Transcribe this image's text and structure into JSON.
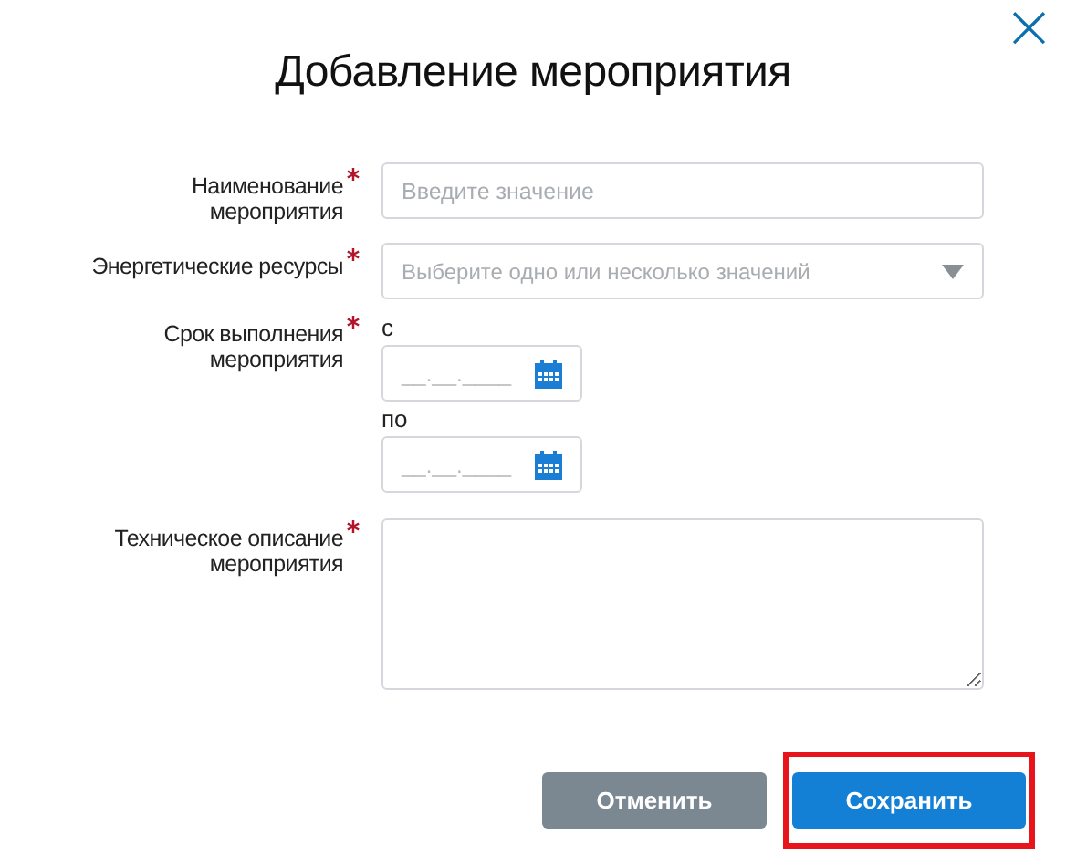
{
  "dialog": {
    "title": "Добавление мероприятия",
    "close": "×"
  },
  "fields": [
    {
      "kind": "text",
      "label": "Наименование мероприятия",
      "required": true,
      "placeholder": "Введите значение"
    },
    {
      "kind": "select",
      "label": "Энергетические ресурсы",
      "required": true,
      "placeholder": "Выберите одно или несколько значений"
    },
    {
      "kind": "daterange",
      "label": "Срок выполнения мероприятия",
      "required": true,
      "from_label": "с",
      "from_placeholder": "__.__.____",
      "to_label": "по",
      "to_placeholder": "__.__.____"
    },
    {
      "kind": "textarea",
      "label": "Техническое описание мероприятия",
      "required": true
    }
  ],
  "buttons": [
    {
      "kind": "secondary",
      "label": "Отменить",
      "highlighted": false
    },
    {
      "kind": "primary",
      "label": "Сохранить",
      "highlighted": true
    }
  ]
}
